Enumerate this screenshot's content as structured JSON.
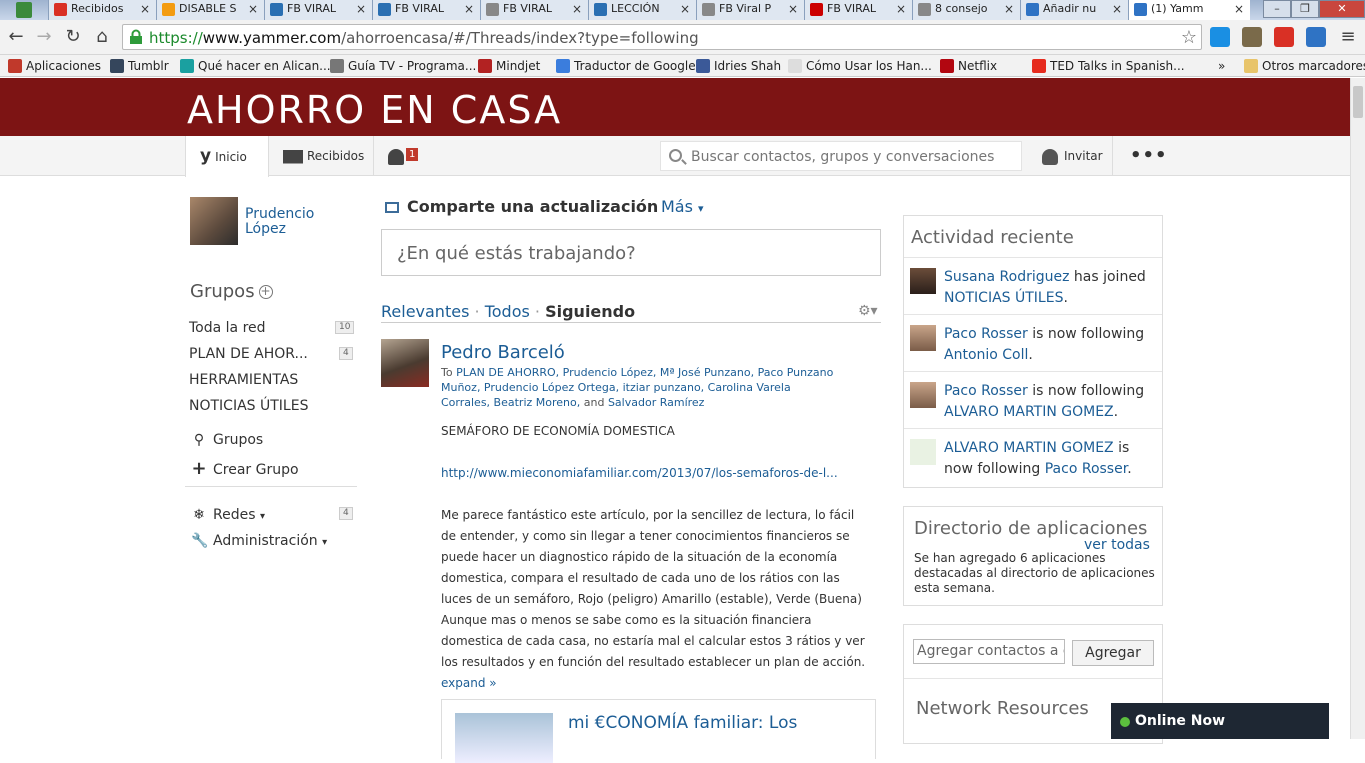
{
  "browser": {
    "tabs": [
      {
        "title": "Recibidos",
        "color": "#d93025"
      },
      {
        "title": "DISABLE S",
        "color": "#f39c12"
      },
      {
        "title": "FB VIRAL",
        "color": "#2a6fb2"
      },
      {
        "title": "FB VIRAL",
        "color": "#2a6fb2"
      },
      {
        "title": "FB VIRAL",
        "color": "#888888"
      },
      {
        "title": "LECCIÓN",
        "color": "#2a6fb2"
      },
      {
        "title": "FB Viral P",
        "color": "#888888"
      },
      {
        "title": "FB VIRAL",
        "color": "#cc0000"
      },
      {
        "title": "8 consejo",
        "color": "#888888"
      },
      {
        "title": "Añadir nu",
        "color": "#2f73c4"
      },
      {
        "title": "(1) Yamm",
        "color": "#2f73c4"
      }
    ],
    "url_proto": "https://",
    "url_host": "www.yammer.com",
    "url_path": "/ahorroencasa/#/Threads/index?type=following",
    "bookmarks": [
      {
        "label": "Aplicaciones",
        "color": "#c0392b"
      },
      {
        "label": "Tumblr",
        "color": "#35465c"
      },
      {
        "label": "Qué hacer en Alican...",
        "color": "#1aa0a0"
      },
      {
        "label": "Guía TV - Programa...",
        "color": "#777777"
      },
      {
        "label": "Mindjet",
        "color": "#b22222"
      },
      {
        "label": "Traductor de Google",
        "color": "#3b7ddd"
      },
      {
        "label": "Idries Shah",
        "color": "#3b5998"
      },
      {
        "label": "Cómo Usar los Han...",
        "color": "#dddddd"
      },
      {
        "label": "Netflix",
        "color": "#b20710"
      },
      {
        "label": "TED Talks in Spanish...",
        "color": "#e62b1e"
      }
    ],
    "bookmarks_more": "»",
    "other_bookmarks": "Otros marcadores"
  },
  "app": {
    "network_title": "AHORRO EN CASA",
    "nav": {
      "home_label": "Inicio",
      "inbox_label": "Recibidos",
      "notif_count": "1",
      "search_placeholder": "Buscar contactos, grupos y conversaciones",
      "invite_label": "Invitar",
      "more_label": "•••"
    }
  },
  "sidebar": {
    "user_name": "Prudencio López",
    "groups_heading": "Grupos",
    "groups": [
      {
        "label": "Toda la red",
        "count": "10"
      },
      {
        "label": "PLAN DE AHOR...",
        "count": "4"
      },
      {
        "label": "HERRAMIENTAS",
        "count": ""
      },
      {
        "label": "NOTICIAS ÚTILES",
        "count": ""
      }
    ],
    "browse_groups": "Grupos",
    "create_group": "Crear Grupo",
    "networks": "Redes",
    "networks_count": "4",
    "admin": "Administración"
  },
  "publisher": {
    "heading": "Comparte una actualización",
    "more": "Más",
    "placeholder": "¿En qué estás trabajando?"
  },
  "feed": {
    "tab_relevant": "Relevantes",
    "tab_all": "Todos",
    "tab_following": "Siguiendo",
    "separator": "·"
  },
  "post": {
    "author": "Pedro Barceló",
    "to_prefix": "To",
    "to_text": "PLAN DE AHORRO, Prudencio López, Mª José Punzano, Paco Punzano Muñoz, Prudencio López Ortega, itziar punzano, Carolina Varela Corrales, Beatriz Moreno,",
    "to_and": "and",
    "to_last": "Salvador Ramírez",
    "title_line": "SEMÁFORO DE ECONOMÍA DOMESTICA",
    "link": "http://www.mieconomiafamiliar.com/2013/07/los-semaforos-de-l...",
    "para1": "Me parece fantástico este artículo, por la sencillez de lectura, lo fácil de entender, y como sin llegar a tener conocimientos financieros se puede hacer un diagnostico rápido de la situación de la economía domestica, compara el resultado de cada uno de los rátios con las luces de un semáforo, Rojo (peligro) Amarillo (estable), Verde (Buena)",
    "para2": "Aunque mas o menos se sabe como es la situación financiera domestica de cada casa, no estaría mal el calcular estos 3 rátios y ver los resultados y en función del resultado establecer un plan de acción.",
    "expand": "expand »",
    "attachment_title": "mi €CONOMÍA familiar: Los"
  },
  "activity": {
    "heading": "Actividad reciente",
    "items": [
      {
        "who": "Susana Rodriguez",
        "action": "has joined",
        "target": "NOTICIAS ÚTILES",
        "end": "."
      },
      {
        "who": "Paco Rosser",
        "action": "is now following",
        "target": "Antonio Coll",
        "end": "."
      },
      {
        "who": "Paco Rosser",
        "action": "is now following",
        "target": "ALVARO MARTIN GOMEZ",
        "end": "."
      },
      {
        "who": "ALVARO MARTIN GOMEZ",
        "action": "is now following",
        "target": "Paco Rosser",
        "end": "."
      }
    ]
  },
  "apps_dir": {
    "heading": "Directorio de aplicaciones",
    "see_all": "ver todas",
    "text": "Se han agregado 6 aplicaciones destacadas al directorio de aplicaciones esta semana."
  },
  "add_contacts": {
    "placeholder": "Agregar contactos a e",
    "button": "Agregar",
    "resources_heading": "Network Resources"
  },
  "chat": {
    "label": "Online Now"
  }
}
